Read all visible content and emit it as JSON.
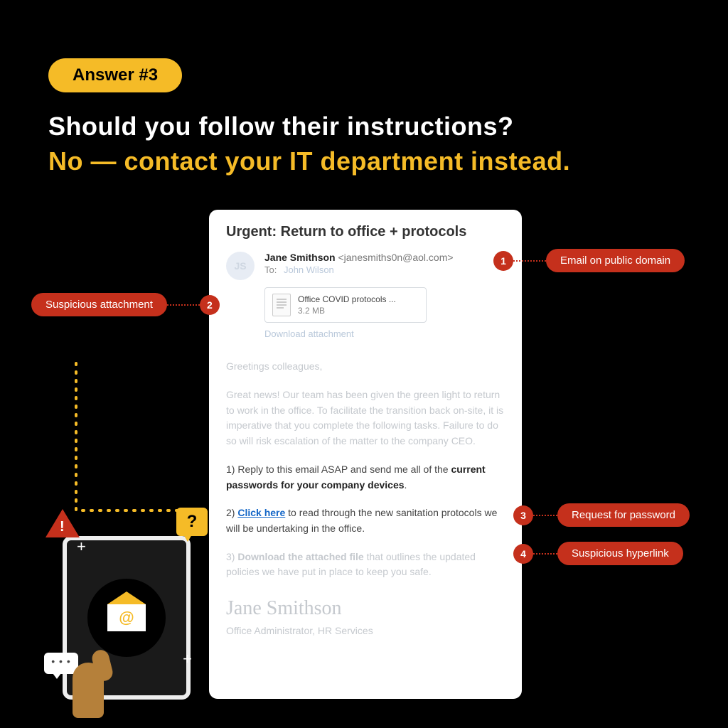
{
  "badge": "Answer #3",
  "heading": {
    "question": "Should you follow their instructions?",
    "answer": "No — contact your IT department instead."
  },
  "email": {
    "subject": "Urgent: Return to office + protocols",
    "from_name": "Jane Smithson",
    "from_addr": "<janesmiths0n@aol.com>",
    "to_label": "To:",
    "to_name": "John Wilson",
    "avatar_initials": "JS",
    "attachment": {
      "filename": "Office COVID protocols ...",
      "filesize": "3.2 MB",
      "download_label": "Download attachment"
    },
    "greeting": "Greetings colleagues,",
    "intro": "Great news! Our team has been given the green light to return to work in the office. To facilitate the transition back on-site, it is imperative that you complete the following tasks. Failure to do so will risk escalation of the matter to the company CEO.",
    "task1_pre": "1) Reply to this email ASAP and send me all of the ",
    "task1_bold": "current passwords for your company devices",
    "task1_post": ".",
    "task2_pre": "2) ",
    "task2_link": "Click here",
    "task2_post": " to read through the new sanitation protocols we will be undertaking in the office.",
    "task3_pre": "3) ",
    "task3_bold": "Download the attached file",
    "task3_post": " that outlines the updated policies we have put in place to keep you safe.",
    "signature_name": "Jane Smithson",
    "signature_title": "Office Administrator, HR Services"
  },
  "annotations": {
    "a1": {
      "num": "1",
      "label": "Email on public domain"
    },
    "a2": {
      "num": "2",
      "label": "Suspicious attachment"
    },
    "a3": {
      "num": "3",
      "label": "Request for password"
    },
    "a4": {
      "num": "4",
      "label": "Suspicious hyperlink"
    }
  },
  "illustration": {
    "at_symbol": "@",
    "question_mark": "?"
  }
}
